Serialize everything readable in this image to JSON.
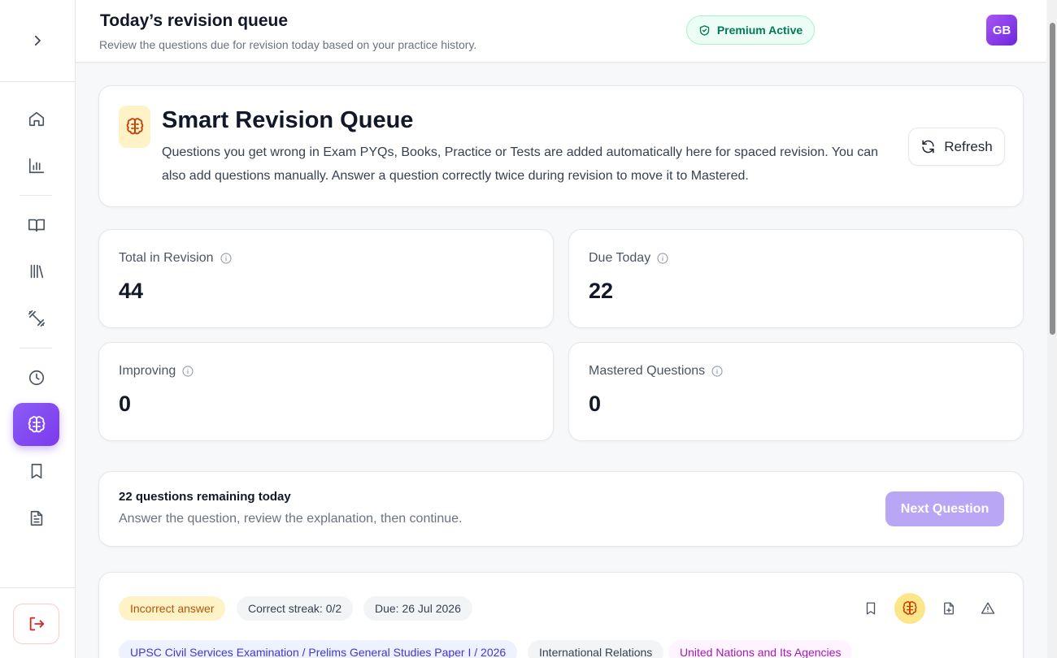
{
  "header": {
    "title": "Today’s revision queue",
    "subtitle": "Review the questions due for revision today based on your practice history.",
    "premium_label": "Premium Active",
    "avatar_initials": "GB"
  },
  "sidebar": {
    "items": [
      {
        "name": "home",
        "icon": "home-icon"
      },
      {
        "name": "analytics",
        "icon": "bar-chart-icon"
      },
      {
        "name": "books",
        "icon": "book-open-icon"
      },
      {
        "name": "library",
        "icon": "library-icon"
      },
      {
        "name": "practice",
        "icon": "dumbbell-icon"
      },
      {
        "name": "history",
        "icon": "clock-icon"
      },
      {
        "name": "revision",
        "icon": "brain-icon",
        "active": true
      },
      {
        "name": "bookmarks",
        "icon": "bookmark-icon"
      },
      {
        "name": "notes",
        "icon": "file-text-icon"
      }
    ],
    "logout_icon": "logout-icon"
  },
  "revision_card": {
    "title": "Smart Revision Queue",
    "description": "Questions you get wrong in Exam PYQs, Books, Practice or Tests are added automatically here for spaced revision. You can also add questions manually. Answer a question correctly twice during revision to move it to Mastered.",
    "refresh_label": "Refresh"
  },
  "stats": {
    "total": {
      "label": "Total in Revision",
      "value": "44"
    },
    "due": {
      "label": "Due Today",
      "value": "22"
    },
    "improving": {
      "label": "Improving",
      "value": "0"
    },
    "mastered": {
      "label": "Mastered Questions",
      "value": "0"
    }
  },
  "remaining": {
    "title": "22 questions remaining today",
    "subtitle": "Answer the question, review the explanation, then continue.",
    "next_label": "Next Question"
  },
  "question": {
    "status": "Incorrect answer",
    "streak": "Correct streak: 0/2",
    "due": "Due: 26 Jul 2026",
    "exam": "UPSC Civil Services Examination / Prelims General Studies Paper I / 2026",
    "subject": "International Relations",
    "topic": "United Nations and Its Agencies"
  },
  "colors": {
    "accent": "#7c3aed",
    "premium_green": "#047857",
    "status_amber": "#b45309"
  }
}
